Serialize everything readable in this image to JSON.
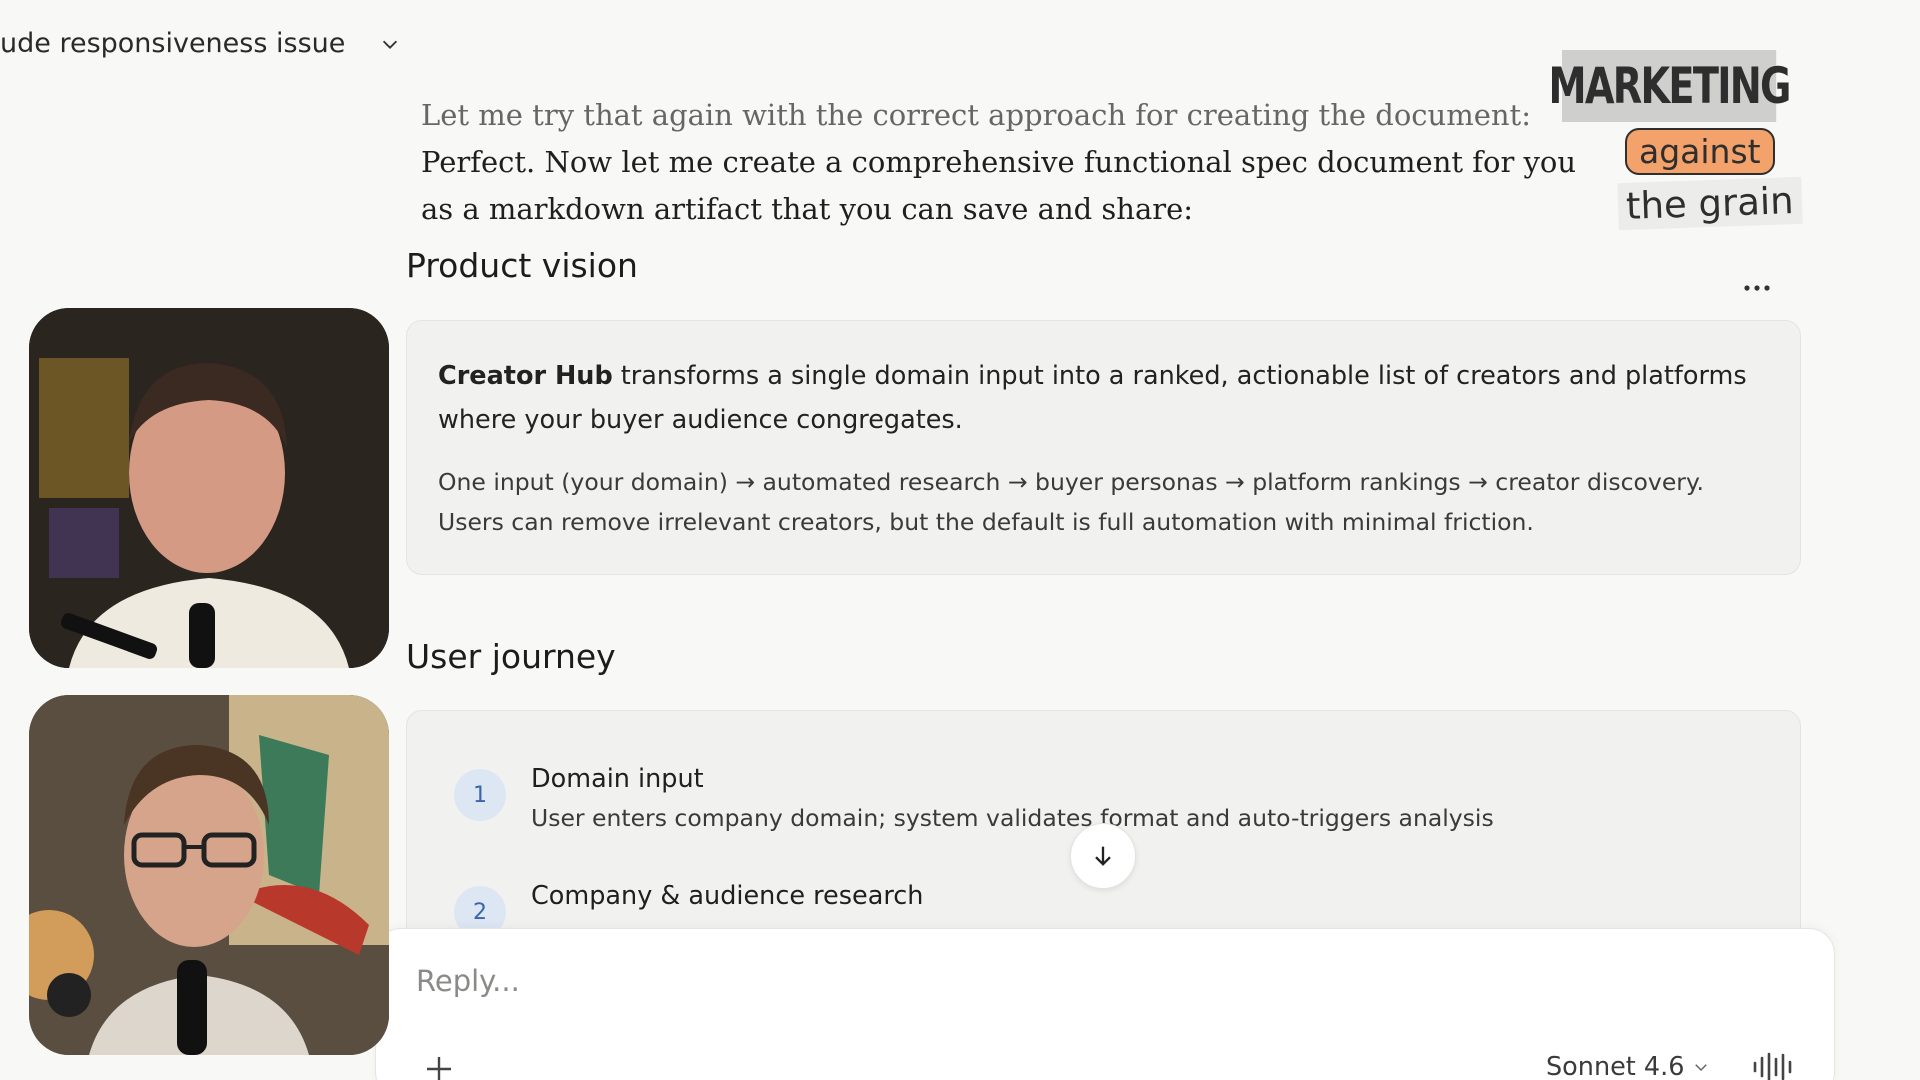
{
  "chat": {
    "title": "ude responsiveness issue"
  },
  "messages": {
    "line1": "Let me try that again with the correct approach for creating the document:",
    "line2": "Perfect. Now let me create a comprehensive functional spec document for you as a markdown artifact that you can save and share:"
  },
  "artifact": {
    "vision_heading": "Product vision",
    "vision_lead_bold": "Creator Hub",
    "vision_lead_rest": " transforms a single domain input into a ranked, actionable list of creators and platforms where your buyer audience congregates.",
    "vision_sub": "One input (your domain) → automated research → buyer personas → platform rankings → creator discovery. Users can remove irrelevant creators, but the default is full automation with minimal friction.",
    "journey_heading": "User journey",
    "steps": [
      {
        "num": "1",
        "title": "Domain input",
        "desc": "User enters company domain; system validates format and auto-triggers analysis"
      },
      {
        "num": "2",
        "title": "Company & audience research",
        "desc": ""
      }
    ]
  },
  "composer": {
    "placeholder": "Reply...",
    "model": "Sonnet 4.6"
  },
  "watermark": {
    "line1": "MARKETING",
    "line2": "against",
    "line3": "the grain"
  },
  "icons": {
    "chevron": "chevron-down-icon",
    "more": "ellipsis-icon",
    "scroll": "arrow-down-icon",
    "plus": "plus-icon",
    "voice": "voice-waveform-icon"
  }
}
